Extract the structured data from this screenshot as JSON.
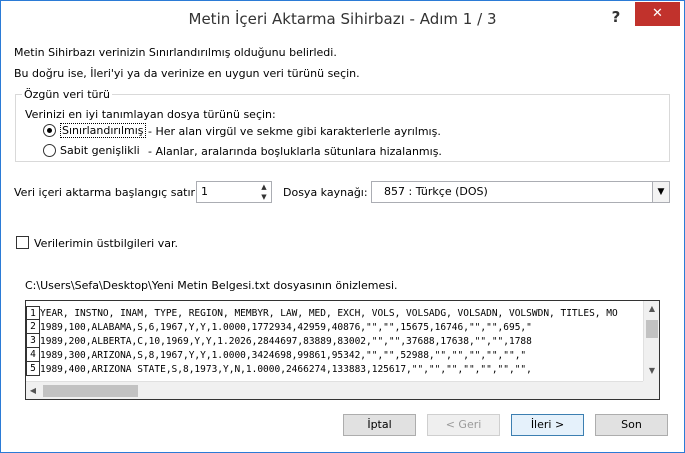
{
  "window": {
    "title": "Metin İçeri Aktarma Sihirbazı - Adım 1 / 3",
    "help_label": "?",
    "close_label": "✕"
  },
  "intro": {
    "line1": "Metin Sihirbazı verinizin Sınırlandırılmış olduğunu belirledi.",
    "line2": "Bu doğru ise, İleri'yi ya da verinize en uygun veri türünü seçin."
  },
  "data_type_group": {
    "label": "Özgün veri türü",
    "prompt": "Verinizi en iyi tanımlayan dosya türünü seçin:",
    "options": [
      {
        "label": "Sınırlandırılmış",
        "description": "- Her alan virgül ve sekme gibi karakterlerle ayrılmış.",
        "selected": true
      },
      {
        "label": "Sabit genişlikli",
        "description": "- Alanlar, aralarında boşluklarla sütunlara hizalanmış.",
        "selected": false
      }
    ]
  },
  "start_row": {
    "label": "Veri içeri aktarma başlangıç satırı:",
    "value": "1"
  },
  "file_origin": {
    "label": "Dosya kaynağı:",
    "value": "857 : Türkçe (DOS)"
  },
  "headers_checkbox": {
    "label": "Verilerimin üstbilgileri var.",
    "checked": false
  },
  "preview": {
    "caption": "C:\\Users\\Sefa\\Desktop\\Yeni Metin Belgesi.txt dosyasının önizlemesi.",
    "row_numbers": [
      "1",
      "2",
      "3",
      "4",
      "5"
    ],
    "lines": [
      "YEAR, INSTNO, INAM, TYPE, REGION, MEMBYR, LAW, MED, EXCH, VOLS, VOLSADG, VOLSADN, VOLSWDN, TITLES, MO",
      "1989,100,ALABAMA,S,6,1967,Y,Y,1.0000,1772934,42959,40876,\"\",\"\",15675,16746,\"\",\"\",695,\"",
      "1989,200,ALBERTA,C,10,1969,Y,Y,1.2026,2844697,83889,83002,\"\",\"\",37688,17638,\"\",\"\",1788",
      "1989,300,ARIZONA,S,8,1967,Y,Y,1.0000,3424698,99861,95342,\"\",\"\",52988,\"\",\"\",\"\",\"\",\"\",\"",
      "1989,400,ARIZONA STATE,S,8,1973,Y,N,1.0000,2466274,133883,125617,\"\",\"\",\"\",\"\",\"\",\"\",\"\","
    ]
  },
  "buttons": {
    "cancel": "İptal",
    "back": "< Geri",
    "next": "İleri >",
    "finish": "Son"
  }
}
